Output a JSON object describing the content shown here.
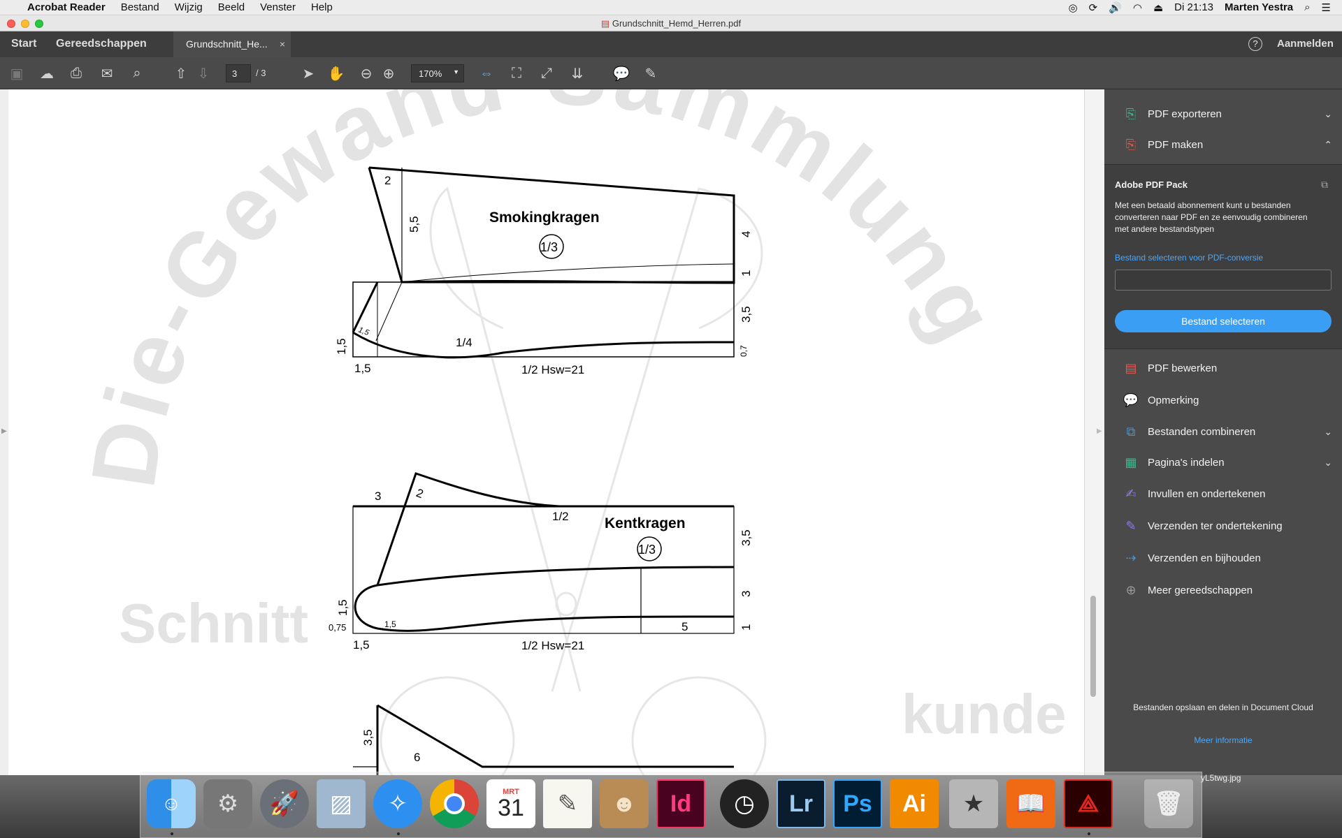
{
  "menubar": {
    "app": "Acrobat Reader",
    "items": [
      "Bestand",
      "Wijzig",
      "Beeld",
      "Venster",
      "Help"
    ],
    "clock": "Di 21:13",
    "user": "Marten Yestra"
  },
  "window": {
    "title": "Grundschnitt_Hemd_Herren.pdf"
  },
  "tabs": {
    "start": "Start",
    "tools": "Gereedschappen",
    "doc": "Grundschnitt_He...",
    "close": "×",
    "help": "?",
    "signin": "Aanmelden"
  },
  "toolbar": {
    "page_current": "3",
    "page_total": "/ 3",
    "zoom": "170%"
  },
  "document": {
    "watermark_top": "Die-Gewand-Sammlung",
    "watermark_bottom_left": "Schnitt",
    "watermark_bottom_right": "kunde",
    "smoking": {
      "title": "Smokingkragen",
      "scale": "1/3",
      "labels": {
        "a": "2",
        "b": "5,5",
        "c": "4",
        "d": "1",
        "e": "3,5",
        "f": "0,7",
        "g": "1,5",
        "h": "1,5",
        "i": "1/4",
        "j": "1,5",
        "k": "1/2 Hsw=21"
      }
    },
    "kent": {
      "title": "Kentkragen",
      "scale": "1/3",
      "labels": {
        "a": "3",
        "b": "2",
        "c": "1/2",
        "d": "3,5",
        "e": "3",
        "f": "1",
        "g": "1,5",
        "h": "0,75",
        "i": "1,5",
        "j": "5",
        "k": "1,5",
        "l": "1/2 Hsw=21"
      }
    },
    "third": {
      "labels": {
        "a": "3,5",
        "b": "6"
      }
    }
  },
  "panel": {
    "tools_top": [
      {
        "label": "PDF exporteren",
        "icon": "export-pdf-icon",
        "color": "#3fb58f"
      },
      {
        "label": "PDF maken",
        "icon": "create-pdf-icon",
        "color": "#e0584f"
      }
    ],
    "pack": {
      "title": "Adobe PDF Pack",
      "desc": "Met een betaald abonnement kunt u bestanden converteren naar PDF en ze eenvoudig combineren met andere bestandstypen",
      "link": "Bestand selecteren voor PDF-conversie",
      "button": "Bestand selecteren"
    },
    "tools": [
      {
        "label": "PDF bewerken",
        "icon": "edit-pdf-icon",
        "color": "#e0584f"
      },
      {
        "label": "Opmerking",
        "icon": "comment-icon",
        "color": "#e8c33a"
      },
      {
        "label": "Bestanden combineren",
        "icon": "combine-icon",
        "color": "#3b9ad9"
      },
      {
        "label": "Pagina's indelen",
        "icon": "organize-pages-icon",
        "color": "#3fb58f"
      },
      {
        "label": "Invullen en ondertekenen",
        "icon": "fill-sign-icon",
        "color": "#8f7ee6"
      },
      {
        "label": "Verzenden ter ondertekening",
        "icon": "send-sign-icon",
        "color": "#8f7ee6"
      },
      {
        "label": "Verzenden en bijhouden",
        "icon": "send-track-icon",
        "color": "#3b9ad9"
      },
      {
        "label": "Meer gereedschappen",
        "icon": "more-tools-icon",
        "color": "#999999"
      }
    ],
    "footer": "Bestanden opslaan en delen in Document Cloud",
    "footer_link": "Meer informatie"
  },
  "dock": {
    "apps": [
      "Finder",
      "System Preferences",
      "Launchpad",
      "Preview",
      "Safari",
      "Chrome",
      "Calendar",
      "TextEdit",
      "Contacts",
      "InDesign",
      "Dashboard",
      "Lightroom",
      "Photoshop",
      "Illustrator",
      "Gallery",
      "iBooks",
      "Acrobat Reader",
      "Trash"
    ],
    "calendar_month": "MRT",
    "calendar_day": "31",
    "id_label": "Id",
    "lr_label": "Lr",
    "ps_label": "Ps",
    "ai_label": "Ai",
    "filename": "yL5twg.jpg"
  }
}
